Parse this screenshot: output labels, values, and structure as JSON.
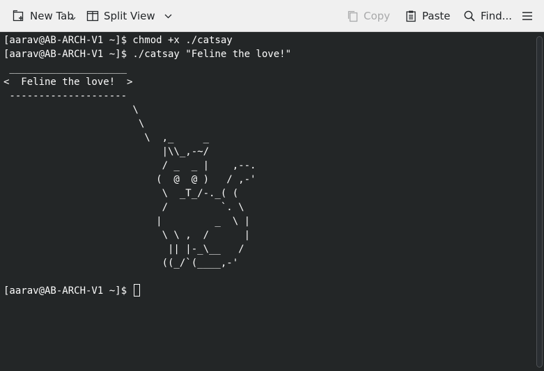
{
  "toolbar": {
    "new_tab": "New Tab",
    "split_view": "Split View",
    "copy": "Copy",
    "paste": "Paste",
    "find": "Find..."
  },
  "terminal": {
    "lines": [
      "[aarav@AB-ARCH-V1 ~]$ chmod +x ./catsay",
      "[aarav@AB-ARCH-V1 ~]$ ./catsay \"Feline the love!\"",
      " ____________________",
      "<  Feline the love!  >",
      " --------------------",
      "                      \\",
      "                       \\",
      "                        \\  ,_     _",
      "                           |\\\\_,-~/",
      "                           / _  _ |    ,--.",
      "                          (  @  @ )   / ,-'",
      "                           \\  _T_/-._( (",
      "                           /         `. \\",
      "                          |         _  \\ |",
      "                           \\ \\ ,  /      |",
      "                            || |-_\\__   /",
      "                           ((_/`(____,-'",
      "",
      "[aarav@AB-ARCH-V1 ~]$ "
    ]
  },
  "colors": {
    "terminal_bg": "#232627",
    "terminal_fg": "#fcfcfc",
    "toolbar_bg": "#f0f0f0"
  }
}
